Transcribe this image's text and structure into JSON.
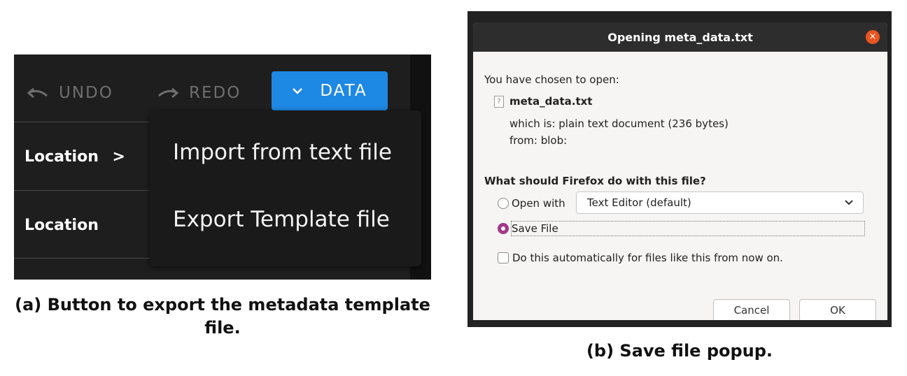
{
  "panel_a": {
    "toolbar": {
      "undo_label": "UNDO",
      "redo_label": "REDO",
      "data_label": "DATA"
    },
    "rows": [
      "Location",
      "Location"
    ],
    "row_chevron": ">",
    "menu": {
      "items": [
        "Import from text file",
        "Export Template file"
      ]
    },
    "caption": "(a) Button to export the metadata template file."
  },
  "panel_b": {
    "title": "Opening meta_data.txt",
    "close_icon": "×",
    "chosen_label": "You have chosen to open:",
    "file_name": "meta_data.txt",
    "file_icon": "?",
    "which_is": "which is: plain text document (236 bytes)",
    "from": "from: blob:",
    "question": "What should Firefox do with this file?",
    "open_with_label": "Open with",
    "app_selected": "Text Editor (default)",
    "save_file_label": "Save File",
    "auto_label": "Do this automatically for files like this from now on.",
    "cancel_label": "Cancel",
    "ok_label": "OK",
    "caption": "(b) Save file popup."
  },
  "colors": {
    "data_button": "#1e88e5",
    "panel_a_bg": "#1e1e1e",
    "dialog_titlebar": "#2d2d2d",
    "close_button": "#e95420",
    "radio_checked": "#a0388a"
  }
}
